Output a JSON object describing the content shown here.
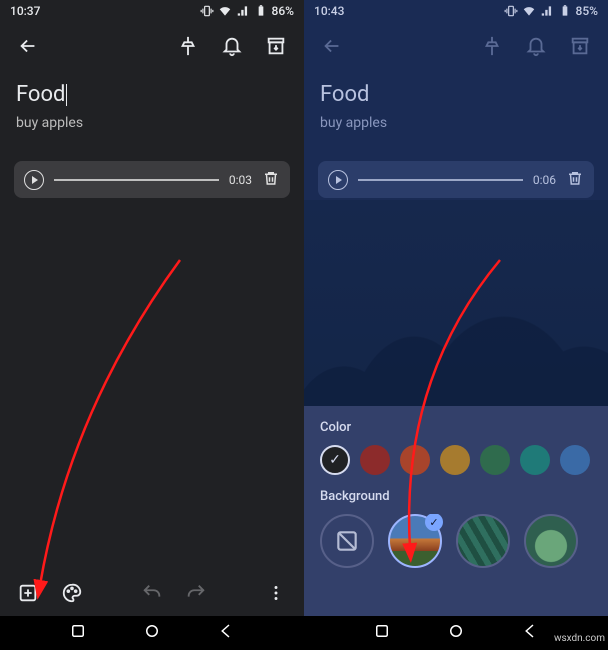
{
  "left": {
    "status": {
      "time": "10:37",
      "battery": "86%"
    },
    "note": {
      "title": "Food",
      "body": "buy apples"
    },
    "audio": {
      "duration": "0:03"
    }
  },
  "right": {
    "status": {
      "time": "10:43",
      "battery": "85%"
    },
    "note": {
      "title": "Food",
      "body": "buy apples"
    },
    "audio": {
      "duration": "0:06"
    },
    "sheet": {
      "color_label": "Color",
      "background_label": "Background",
      "colors": [
        "#202124",
        "#8c2b2b",
        "#a8442b",
        "#a67b2f",
        "#2f6b4d",
        "#1f7a78",
        "#3a6aa6",
        "#5a4a8c"
      ],
      "selected_color_index": 0,
      "selected_bg_index": 1
    }
  },
  "watermark": "wsxdn.com"
}
